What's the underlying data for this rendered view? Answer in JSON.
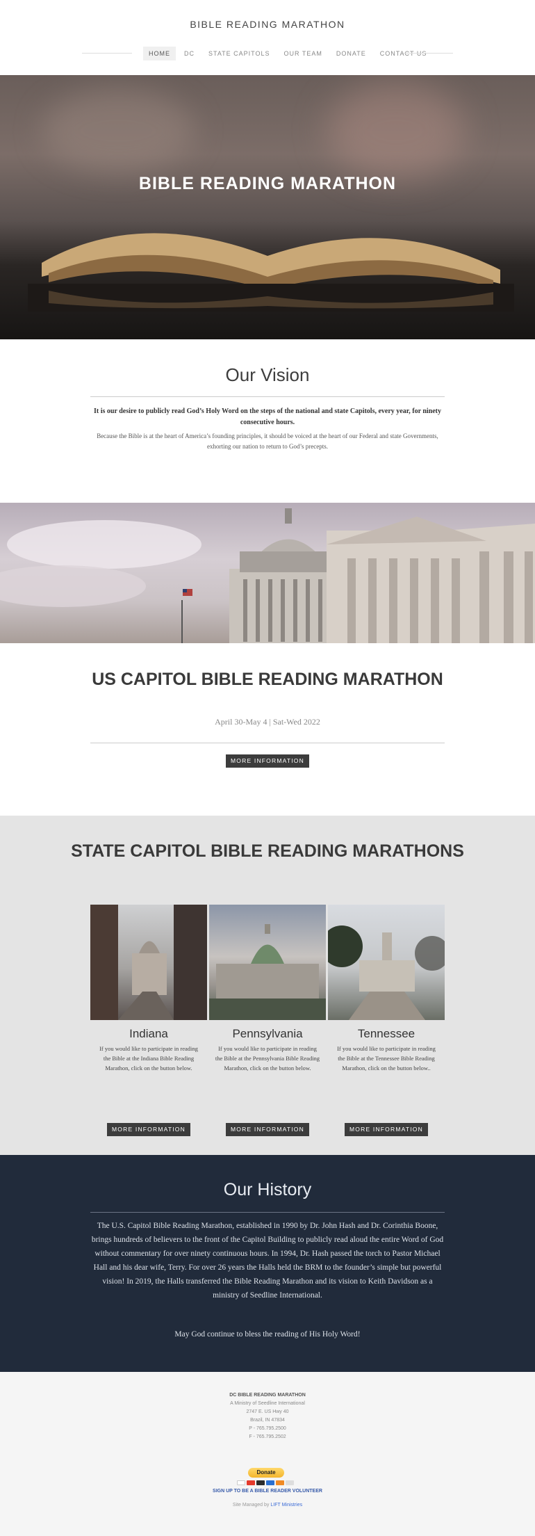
{
  "site": {
    "title": "BIBLE READING MARATHON"
  },
  "nav": {
    "items": [
      {
        "label": "HOME",
        "active": true
      },
      {
        "label": "DC",
        "active": false
      },
      {
        "label": "STATE CAPITOLS",
        "active": false
      },
      {
        "label": "OUR TEAM",
        "active": false
      },
      {
        "label": "DONATE",
        "active": false
      },
      {
        "label": "CONTACT US",
        "active": false
      }
    ]
  },
  "hero": {
    "title": "BIBLE READING MARATHON"
  },
  "vision": {
    "title": "Our Vision",
    "bold_text": "It is our desire to publicly read God’s Holy Word on the steps of the national and state Capitols, every year, for ninety consecutive hours.",
    "text": "Because the Bible is at the heart of America’s founding principles, it should be voiced at the heart of our Federal and state Governments, exhorting our nation to return to God’s precepts."
  },
  "capitol": {
    "title": "US CAPITOL BIBLE READING MARATHON",
    "date": "April 30-May 4 | Sat-Wed 2022",
    "button": "MORE INFORMATION"
  },
  "state": {
    "title": "STATE CAPITOL BIBLE READING MARATHONS",
    "cards": [
      {
        "name": "Indiana",
        "text": "If you would like to participate in reading the Bible at the Indiana Bible Reading Marathon, click on the button below.",
        "button": "MORE INFORMATION"
      },
      {
        "name": "Pennsylvania",
        "text": "If you would like to participate in reading the Bible at the Pennsylvania Bible Reading Marathon, click on the button below.",
        "button": "MORE INFORMATION"
      },
      {
        "name": "Tennessee",
        "text": "If you would like to participate in reading the Bible at the Tennessee Bible Reading Marathon, click on the button below..",
        "button": "MORE INFORMATION"
      }
    ]
  },
  "history": {
    "title": "Our History",
    "text": "The U.S. Capitol Bible Reading Marathon, established in 1990 by Dr. John Hash and Dr. Corinthia Boone, brings hundreds of believers to the front of the Capitol Building to publicly read aloud the entire Word of God without commentary for over ninety continuous hours. In 1994, Dr. Hash passed the torch to Pastor Michael Hall and his dear wife, Terry. For over 26 years the Halls held the BRM to the founder’s simple but powerful vision! In 2019, the Halls transferred the Bible Reading Marathon and its vision to Keith Davidson as a ministry of Seedline International.",
    "blessing": "May God continue to bless the reading of His Holy Word!"
  },
  "footer": {
    "name": "DC BIBLE READING MARATHON",
    "lines": [
      "A Ministry of Seedline International",
      "2747 E. US Hwy 40",
      "Brazil, IN 47834",
      "P - 765.795.2500",
      "F - 765.795.2502"
    ],
    "donate": "Donate",
    "volunteer": "SIGN UP TO BE A BIBLE READER VOLUNTEER",
    "managed_prefix": "Site Managed by",
    "managed_link": "LIFT Ministries"
  }
}
